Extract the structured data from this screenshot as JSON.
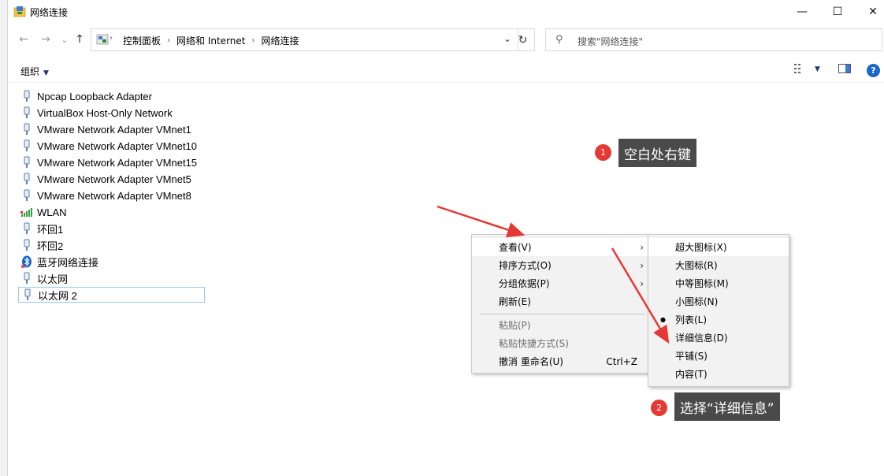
{
  "window": {
    "title": "网络连接",
    "controls": {
      "minimize": "—",
      "maximize": "☐",
      "close": "✕"
    }
  },
  "nav": {
    "back": "←",
    "forward": "→",
    "recent": "⌄",
    "up": "↑",
    "breadcrumb": [
      "控制面板",
      "网络和 Internet",
      "网络连接"
    ],
    "search_placeholder": "搜索\"网络连接\""
  },
  "toolbar": {
    "organize": "组织"
  },
  "adapters": [
    {
      "name": "Npcap Loopback Adapter",
      "icon": "network-adapter-icon"
    },
    {
      "name": "VirtualBox Host-Only Network",
      "icon": "network-adapter-icon"
    },
    {
      "name": "VMware Network Adapter VMnet1",
      "icon": "network-adapter-icon"
    },
    {
      "name": "VMware Network Adapter VMnet10",
      "icon": "network-adapter-icon"
    },
    {
      "name": "VMware Network Adapter VMnet15",
      "icon": "network-adapter-icon"
    },
    {
      "name": "VMware Network Adapter VMnet5",
      "icon": "network-adapter-icon"
    },
    {
      "name": "VMware Network Adapter VMnet8",
      "icon": "network-adapter-icon"
    },
    {
      "name": "WLAN",
      "icon": "wifi-signal-icon"
    },
    {
      "name": "环回1",
      "icon": "network-adapter-icon"
    },
    {
      "name": "环回2",
      "icon": "network-adapter-icon"
    },
    {
      "name": "蓝牙网络连接",
      "icon": "bluetooth-icon"
    },
    {
      "name": "以太网",
      "icon": "network-adapter-icon"
    },
    {
      "name": "以太网 2",
      "icon": "network-adapter-icon",
      "selected": true
    }
  ],
  "context_menu": {
    "items": [
      {
        "label": "查看(V)",
        "submenu": true,
        "highlighted": true
      },
      {
        "label": "排序方式(O)",
        "submenu": true
      },
      {
        "label": "分组依据(P)",
        "submenu": true
      },
      {
        "label": "刷新(E)"
      },
      {
        "label": "粘贴(P)",
        "disabled": true
      },
      {
        "label": "粘贴快捷方式(S)",
        "disabled": true
      },
      {
        "label": "撤消 重命名(U)",
        "accelerator": "Ctrl+Z"
      }
    ]
  },
  "view_submenu": {
    "items": [
      {
        "label": "超大图标(X)",
        "highlighted": true
      },
      {
        "label": "大图标(R)"
      },
      {
        "label": "中等图标(M)"
      },
      {
        "label": "小图标(N)"
      },
      {
        "label": "列表(L)",
        "checked": true
      },
      {
        "label": "详细信息(D)"
      },
      {
        "label": "平铺(S)"
      },
      {
        "label": "内容(T)"
      }
    ]
  },
  "annotations": [
    {
      "number": "1",
      "text": "空白处右键"
    },
    {
      "number": "2",
      "text": "选择“详细信息”"
    }
  ],
  "colors": {
    "annotation_red": "#e53935",
    "callout_bg": "#4a4a4a",
    "selection_border": "#99c9ef",
    "help_blue": "#1a66cc"
  }
}
